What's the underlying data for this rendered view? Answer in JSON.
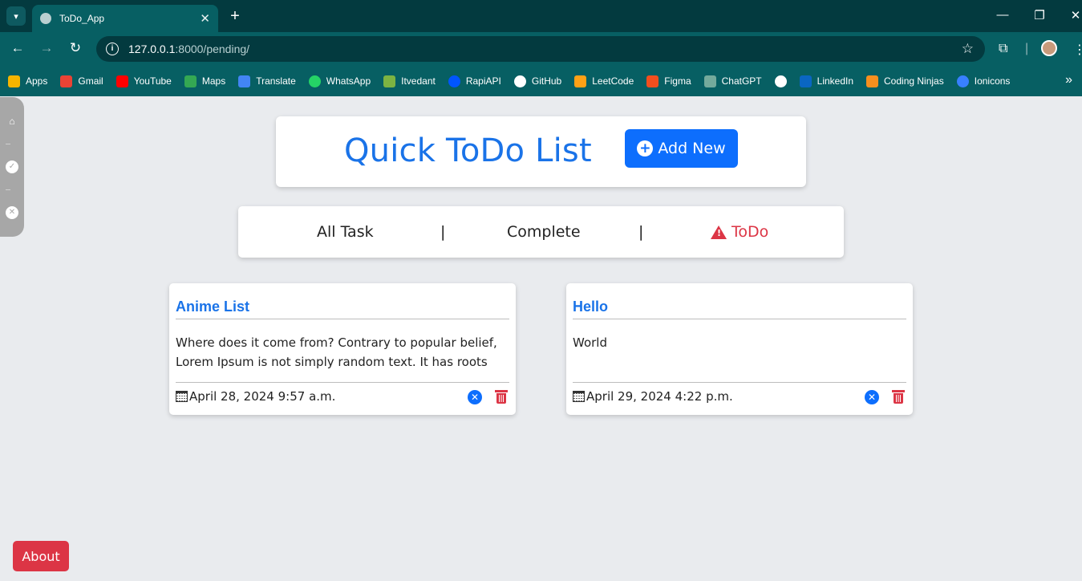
{
  "browser": {
    "tab_title": "ToDo_App",
    "tab_close": "✕",
    "new_tab": "+",
    "url_host": "127.0.0.1",
    "url_path": ":8000/pending/",
    "minimize": "—",
    "restore": "❐",
    "close": "✕",
    "back": "←",
    "forward": "→",
    "reload": "↻"
  },
  "bookmarks": [
    {
      "label": "Apps",
      "color": "#f4b400"
    },
    {
      "label": "Gmail",
      "color": "#ea4335"
    },
    {
      "label": "YouTube",
      "color": "#ff0000"
    },
    {
      "label": "Maps",
      "color": "#34a853"
    },
    {
      "label": "Translate",
      "color": "#4285f4"
    },
    {
      "label": "WhatsApp",
      "color": "#25d366"
    },
    {
      "label": "Itvedant",
      "color": "#7cb342"
    },
    {
      "label": "RapiAPI",
      "color": "#0055ff"
    },
    {
      "label": "GitHub",
      "color": "#ffffff"
    },
    {
      "label": "LeetCode",
      "color": "#ffa116"
    },
    {
      "label": "Figma",
      "color": "#f24e1e"
    },
    {
      "label": "ChatGPT",
      "color": "#74aa9c"
    },
    {
      "label": "",
      "color": "#ffffff"
    },
    {
      "label": "LinkedIn",
      "color": "#0a66c2"
    },
    {
      "label": "Coding Ninjas",
      "color": "#f78f1e"
    },
    {
      "label": "Ionicons",
      "color": "#3880ff"
    }
  ],
  "header": {
    "title": "Quick ToDo List",
    "add_button": "Add New"
  },
  "filters": {
    "all": "All Task",
    "separator": "|",
    "complete": "Complete",
    "todo": "ToDo"
  },
  "tasks": [
    {
      "title": "Anime List",
      "body": "Where does it come from? Contrary to popular belief, Lorem Ipsum is not simply random text. It has roots in...",
      "date": "April 28, 2024 9:57 a.m."
    },
    {
      "title": "Hello",
      "body": "World",
      "date": "April 29, 2024 4:22 p.m."
    }
  ],
  "about_button": "About",
  "colors": {
    "accent": "#0d6efd",
    "title_blue": "#1a73e8",
    "danger": "#dc3545",
    "chrome_dark": "#033a3f",
    "chrome": "#075f63"
  }
}
